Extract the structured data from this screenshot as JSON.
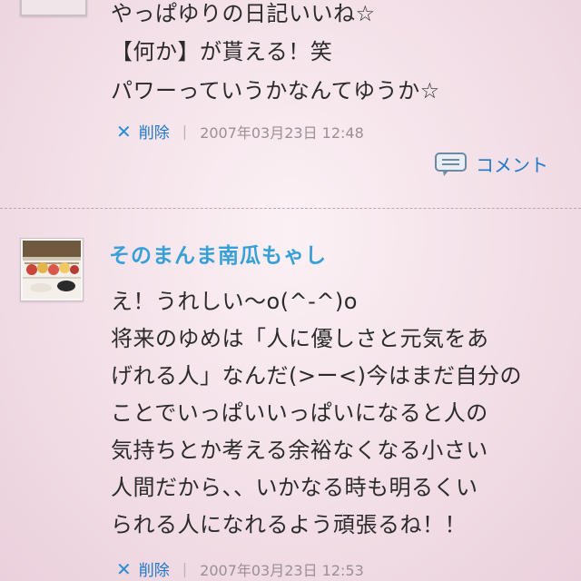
{
  "comment1": {
    "lines": [
      "やっぱゆりの日記いいね☆",
      "【何か】が貰える！笑",
      "パワーっていうかなんてゆうか☆"
    ],
    "delete_label": "削除",
    "separator": "|",
    "date": "2007年03月23日 12:48"
  },
  "comment_button": {
    "label": "コメント",
    "icon": "comment-bubble-icon"
  },
  "comment2": {
    "username": "そのまんま南瓜もゃし",
    "lines": [
      "え！うれしい〜o(^-^)o",
      "将来のゆめは「人に優しさと元気をあ",
      "げれる人」なんだ(>ー<)今はまだ自分の",
      "ことでいっぱいいっぱいになると人の",
      "気持ちとか考える余裕なくなる小さい",
      "人間だから、、いかなる時も明るくい",
      "られる人になれるよう頑張るね！！"
    ],
    "delete_label": "削除",
    "separator": "|",
    "date": "2007年03月23日 12:53"
  },
  "colors": {
    "accent_blue": "#1f79c8",
    "username_blue": "#37a0d8",
    "background_pink": "#f3dfe7"
  }
}
